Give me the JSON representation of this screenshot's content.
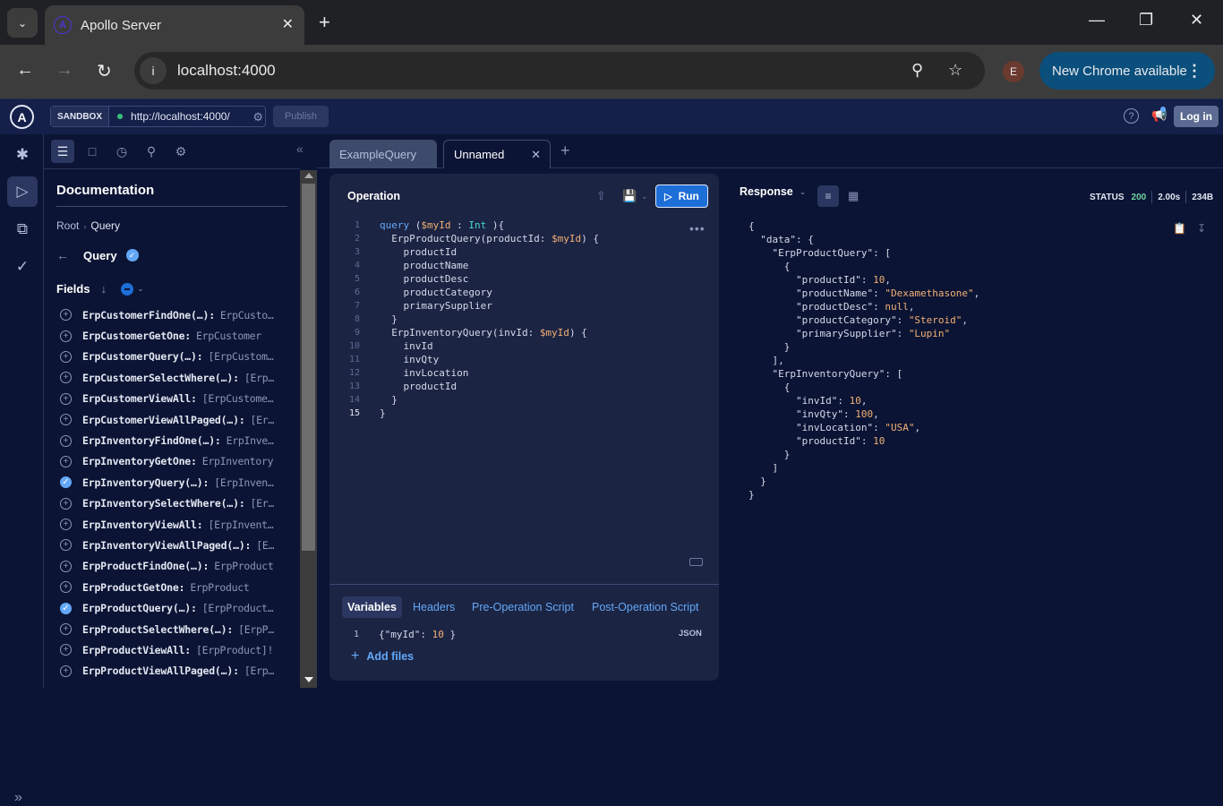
{
  "browser": {
    "tab_title": "Apollo Server",
    "url": "localhost:4000",
    "profile_initial": "E",
    "update_button": "New Chrome available"
  },
  "apollo": {
    "sandbox_label": "SANDBOX",
    "endpoint_url": "http://localhost:4000/",
    "publish_label": "Publish",
    "login_label": "Log in"
  },
  "docs": {
    "title": "Documentation",
    "breadcrumb": [
      "Root",
      "Query"
    ],
    "type_title": "Query",
    "fields_title": "Fields",
    "fields": [
      {
        "name": "ErpCustomerFindOne(…):",
        "type": "ErpCusto…",
        "selected": false
      },
      {
        "name": "ErpCustomerGetOne:",
        "type": "ErpCustomer",
        "selected": false
      },
      {
        "name": "ErpCustomerQuery(…):",
        "type": "[ErpCustom…",
        "selected": false
      },
      {
        "name": "ErpCustomerSelectWhere(…):",
        "type": "[Erp…",
        "selected": false
      },
      {
        "name": "ErpCustomerViewAll:",
        "type": "[ErpCustome…",
        "selected": false
      },
      {
        "name": "ErpCustomerViewAllPaged(…):",
        "type": "[Er…",
        "selected": false
      },
      {
        "name": "ErpInventoryFindOne(…):",
        "type": "ErpInve…",
        "selected": false
      },
      {
        "name": "ErpInventoryGetOne:",
        "type": "ErpInventory",
        "selected": false
      },
      {
        "name": "ErpInventoryQuery(…):",
        "type": "[ErpInven…",
        "selected": true
      },
      {
        "name": "ErpInventorySelectWhere(…):",
        "type": "[Er…",
        "selected": false
      },
      {
        "name": "ErpInventoryViewAll:",
        "type": "[ErpInvent…",
        "selected": false
      },
      {
        "name": "ErpInventoryViewAllPaged(…):",
        "type": "[E…",
        "selected": false
      },
      {
        "name": "ErpProductFindOne(…):",
        "type": "ErpProduct",
        "selected": false
      },
      {
        "name": "ErpProductGetOne:",
        "type": "ErpProduct",
        "selected": false
      },
      {
        "name": "ErpProductQuery(…):",
        "type": "[ErpProduct…",
        "selected": true
      },
      {
        "name": "ErpProductSelectWhere(…):",
        "type": "[ErpP…",
        "selected": false
      },
      {
        "name": "ErpProductViewAll:",
        "type": "[ErpProduct]!",
        "selected": false
      },
      {
        "name": "ErpProductViewAllPaged(…):",
        "type": "[Erp…",
        "selected": false
      }
    ]
  },
  "tabs": [
    {
      "label": "ExampleQuery",
      "active": false
    },
    {
      "label": "Unnamed",
      "active": true
    }
  ],
  "operation": {
    "title": "Operation",
    "run_label": "Run",
    "lines": [
      "query ($myId : Int ){",
      "  ErpProductQuery(productId: $myId) {",
      "    productId",
      "    productName",
      "    productDesc",
      "    productCategory",
      "    primarySupplier",
      "  }",
      "  ErpInventoryQuery(invId: $myId) {",
      "    invId",
      "    invQty",
      "    invLocation",
      "    productId",
      "  }",
      "}"
    ]
  },
  "bottom_tabs": [
    "Variables",
    "Headers",
    "Pre-Operation Script",
    "Post-Operation Script"
  ],
  "variables": {
    "line": "{\"myId\": 10 }",
    "format": "JSON",
    "add_files_label": "Add files"
  },
  "response": {
    "title": "Response",
    "status_label": "STATUS",
    "status_code": "200",
    "time": "2.00s",
    "size": "234B",
    "lines": [
      "{",
      "  \"data\": {",
      "    \"ErpProductQuery\": [",
      "      {",
      "        \"productId\": 10,",
      "        \"productName\": \"Dexamethasone\",",
      "        \"productDesc\": null,",
      "        \"productCategory\": \"Steroid\",",
      "        \"primarySupplier\": \"Lupin\"",
      "      }",
      "    ],",
      "    \"ErpInventoryQuery\": [",
      "      {",
      "        \"invId\": 10,",
      "        \"invQty\": 100,",
      "        \"invLocation\": \"USA\",",
      "        \"productId\": 10",
      "      }",
      "    ]",
      "  }",
      "}"
    ]
  }
}
